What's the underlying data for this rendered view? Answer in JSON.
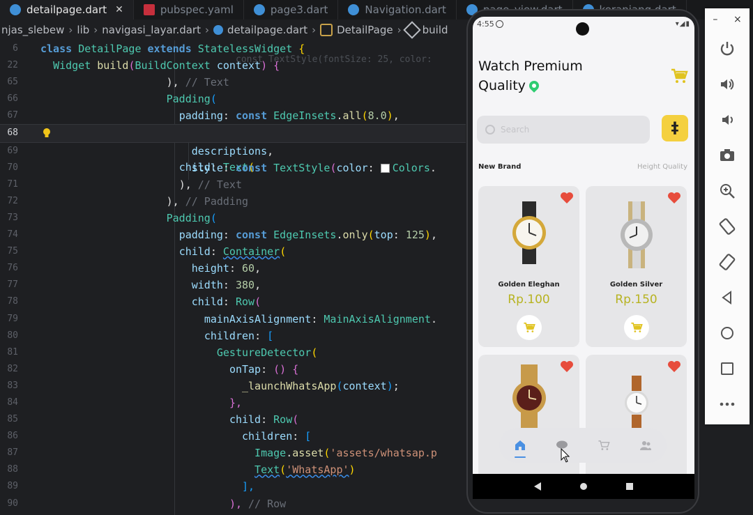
{
  "tabs": [
    {
      "label": "detailpage.dart",
      "icon": "dart-file-icon",
      "active": true
    },
    {
      "label": "pubspec.yaml",
      "icon": "yaml-file-icon",
      "active": false
    },
    {
      "label": "page3.dart",
      "icon": "dart-file-icon",
      "active": false
    },
    {
      "label": "Navigation.dart",
      "icon": "dart-file-icon",
      "active": false
    },
    {
      "label": "page_view.dart",
      "icon": "dart-file-icon",
      "active": false
    },
    {
      "label": "keranjang.dart",
      "icon": "dart-file-icon",
      "active": false
    }
  ],
  "breadcrumb": [
    "njas_slebew",
    "lib",
    "navigasi_layar.dart",
    "detailpage.dart",
    "DetailPage",
    "build"
  ],
  "code_lines": [
    {
      "n": "6"
    },
    {
      "n": "22"
    },
    {
      "n": "65"
    },
    {
      "n": "66"
    },
    {
      "n": "67"
    },
    {
      "n": "68"
    },
    {
      "n": "69"
    },
    {
      "n": "70"
    },
    {
      "n": "71"
    },
    {
      "n": "72"
    },
    {
      "n": "73"
    },
    {
      "n": "74"
    },
    {
      "n": "75"
    },
    {
      "n": "76"
    },
    {
      "n": "77"
    },
    {
      "n": "78"
    },
    {
      "n": "79"
    },
    {
      "n": "80"
    },
    {
      "n": "81"
    },
    {
      "n": "82"
    },
    {
      "n": "83"
    },
    {
      "n": "84"
    },
    {
      "n": "85"
    },
    {
      "n": "86"
    },
    {
      "n": "87"
    },
    {
      "n": "88"
    },
    {
      "n": "89"
    },
    {
      "n": "90"
    }
  ],
  "code": {
    "l6": [
      "class",
      "DetailPage",
      "extends",
      "StatelessWidget",
      "{"
    ],
    "l22": [
      "Widget",
      "build",
      "(",
      "BuildContext",
      "context",
      ")",
      "{"
    ],
    "l22_ghost": "const TextStyle(fontSize: 25, color:",
    "l65": [
      "),",
      "// Text"
    ],
    "l66": [
      "Padding",
      "("
    ],
    "l67": [
      "padding",
      ":",
      "const",
      "EdgeInsets",
      ".",
      "all",
      "(",
      "8.0",
      ")",
      ","
    ],
    "l68": [
      "child",
      ":",
      "Text",
      "("
    ],
    "l69": [
      "descriptions",
      ","
    ],
    "l70": [
      "style",
      ":",
      "const",
      "TextStyle",
      "(",
      "color",
      ":",
      "Colors",
      "."
    ],
    "l71": [
      "),",
      "// Text"
    ],
    "l72": [
      "),",
      "// Padding"
    ],
    "l73": [
      "Padding",
      "("
    ],
    "l74": [
      "padding",
      ":",
      "const",
      "EdgeInsets",
      ".",
      "only",
      "(",
      "top",
      ":",
      "125",
      ")",
      ","
    ],
    "l75": [
      "child",
      ":",
      "Container",
      "("
    ],
    "l76": [
      "height",
      ":",
      "60",
      ","
    ],
    "l77": [
      "width",
      ":",
      "380",
      ","
    ],
    "l78": [
      "child",
      ":",
      "Row",
      "("
    ],
    "l79": [
      "mainAxisAlignment",
      ":",
      "MainAxisAlignment",
      "."
    ],
    "l80": [
      "children",
      ":",
      "["
    ],
    "l81": [
      "GestureDetector",
      "("
    ],
    "l82": [
      "onTap",
      ":",
      "()",
      "{"
    ],
    "l83": [
      "_launchWhatsApp",
      "(",
      "context",
      ")",
      ";"
    ],
    "l84": [
      "},"
    ],
    "l85": [
      "child",
      ":",
      "Row",
      "("
    ],
    "l86": [
      "children",
      ":",
      "["
    ],
    "l87": [
      "Image",
      ".",
      "asset",
      "(",
      "'assets/whatsap.p"
    ],
    "l88": [
      "Text",
      "(",
      "'WhatsApp'",
      ")"
    ],
    "l89": [
      "],"
    ],
    "l90": [
      "),",
      "// Row"
    ]
  },
  "phone": {
    "time": "4:55",
    "status_right": "▾◢▮",
    "title_line1": "Watch Premium",
    "title_line2": "Quality",
    "search_placeholder": "Search",
    "filter_symbol": "‡",
    "section_left": "New Brand",
    "section_right": "Height Quality",
    "products": [
      {
        "name": "Golden Eleghan",
        "price": "Rp.100"
      },
      {
        "name": "Golden Silver",
        "price": "Rp.150"
      },
      {
        "name": "",
        "price": ""
      },
      {
        "name": "",
        "price": ""
      }
    ],
    "nav": [
      "home-icon",
      "chat-icon",
      "cart-icon",
      "people-icon"
    ]
  },
  "emulator_toolbar": [
    "power-icon",
    "volume-up-icon",
    "volume-down-icon",
    "camera-icon",
    "zoom-in-icon",
    "rotate-left-icon",
    "rotate-right-icon",
    "back-icon",
    "home-circle-icon",
    "overview-square-icon",
    "more-icon"
  ],
  "emulator_window": {
    "minimize": "–",
    "close": "×"
  }
}
